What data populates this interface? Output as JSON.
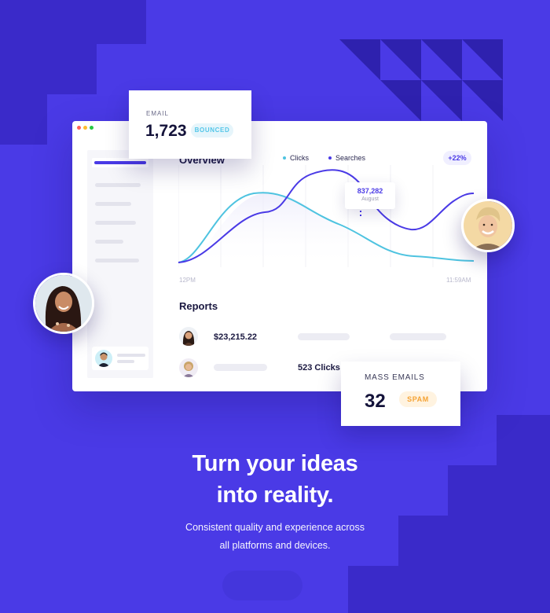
{
  "overview": {
    "title": "Overview",
    "legend": [
      {
        "label": "Clicks",
        "color": "#4ec3e0"
      },
      {
        "label": "Searches",
        "color": "#4a3ae6"
      }
    ],
    "change_badge": "+22%",
    "tooltip": {
      "value": "837,282",
      "label": "August"
    },
    "x_start_label": "12PM",
    "x_end_label": "11:59AM"
  },
  "reports": {
    "title": "Reports",
    "rows": [
      {
        "value": "$23,215.22"
      },
      {
        "value": "523 Clicks"
      }
    ]
  },
  "email_card": {
    "label": "EMAIL",
    "value": "1,723",
    "badge": "BOUNCED"
  },
  "mass_card": {
    "label": "MASS EMAILS",
    "value": "32",
    "badge": "SPAM"
  },
  "hero": {
    "headline_line1": "Turn your ideas",
    "headline_line2": "into reality.",
    "subline_line1": "Consistent quality and experience across",
    "subline_line2": "all platforms and devices."
  },
  "colors": {
    "background": "#4a3ae6",
    "background_dark": "#3a2ac9",
    "accent": "#4a3ae6",
    "clicks": "#4ec3e0",
    "bounced": "#53c6e8",
    "spam": "#f5a233"
  }
}
